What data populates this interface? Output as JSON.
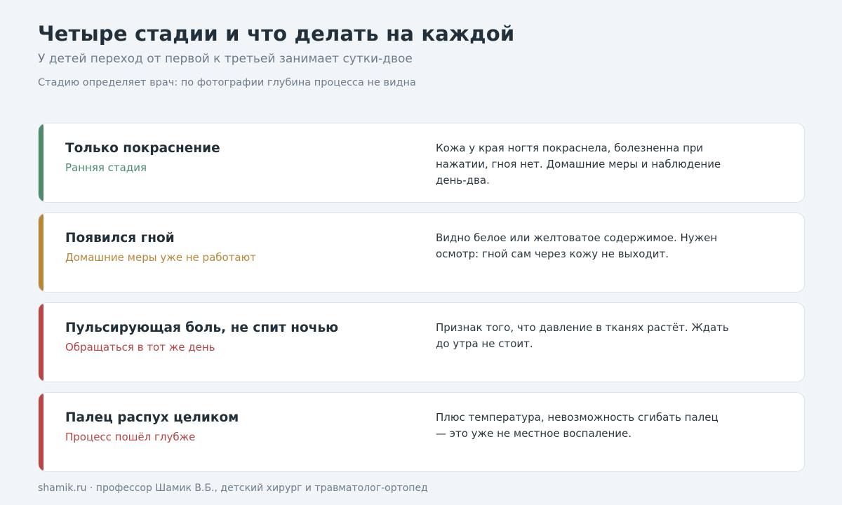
{
  "header": {
    "title": "Четыре стадии и что делать на каждой",
    "subtitle": "У детей переход от первой к третьей занимает сутки-двое",
    "note": "Стадию определяет врач: по фотографии глубина процесса не видна"
  },
  "cards": [
    {
      "name": "Только покраснение",
      "stage": "Ранняя стадия",
      "description": "Кожа у края ногтя покраснела, болезненна при нажатии, гноя нет. Домашние меры и наблюдение день-два.",
      "color": "#4e8b6d"
    },
    {
      "name": "Появился гной",
      "stage": "Домашние меры уже не работают",
      "description": "Видно белое или желтоватое содержимое. Нужен осмотр: гной сам через кожу не выходит.",
      "color": "#b9873a"
    },
    {
      "name": "Пульсирующая боль, не спит ночью",
      "stage": "Обращаться в тот же день",
      "description": "Признак того, что давление в тканях растёт. Ждать до утра не стоит.",
      "color": "#b84545"
    },
    {
      "name": "Палец распух целиком",
      "stage": "Процесс пошёл глубже",
      "description": "Плюс температура, невозможность сгибать палец — это уже не местное воспаление.",
      "color": "#b84545"
    }
  ],
  "footer": {
    "text": "shamik.ru · профессор Шамик В.Б., детский хирург и травматолог-ортопед"
  }
}
